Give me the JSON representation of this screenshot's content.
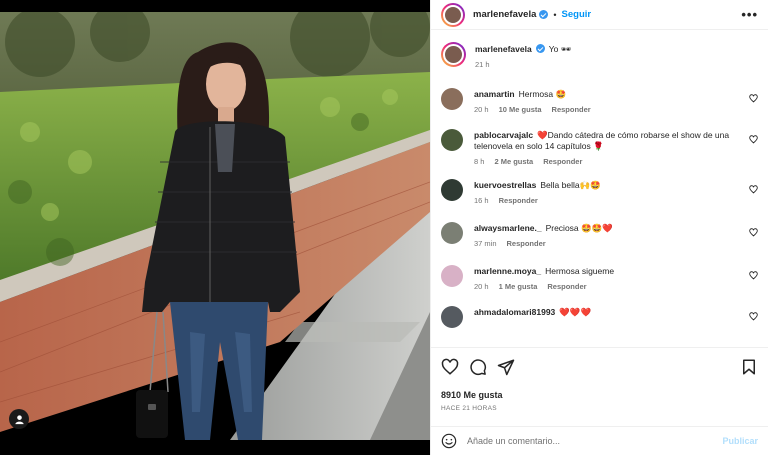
{
  "post": {
    "username": "marlenefavela",
    "follow_label": "Seguir",
    "more_label": "•••"
  },
  "caption": {
    "username": "marlenefavela",
    "text": "Yo 🕶",
    "time": "21 h"
  },
  "comments": [
    {
      "username": "anamartin",
      "text": "Hermosa 🤩",
      "time": "20 h",
      "likes": "10 Me gusta",
      "reply": "Responder",
      "avatar_color": "#8a6e5c"
    },
    {
      "username": "pablocarvajalc",
      "text": "❤️Dando cátedra de cómo robarse el show de una telenovela en solo 14 capítulos 🌹",
      "time": "8 h",
      "likes": "2 Me gusta",
      "reply": "Responder",
      "avatar_color": "#4a5a3a"
    },
    {
      "username": "kuervoestrellas",
      "text": "Bella bella🙌🤩",
      "time": "16 h",
      "likes": "",
      "reply": "Responder",
      "avatar_color": "#2f3a33"
    },
    {
      "username": "alwaysmarlene._",
      "text": "Preciosa 🤩🤩❤️",
      "time": "37 min",
      "likes": "",
      "reply": "Responder",
      "avatar_color": "#7b7f74"
    },
    {
      "username": "marlenne.moya_",
      "text": "Hermosa sigueme",
      "time": "20 h",
      "likes": "1 Me gusta",
      "reply": "Responder",
      "avatar_color": "#d8b1c6"
    },
    {
      "username": "ahmadalomari81993",
      "text": "❤️❤️❤️",
      "time": "",
      "likes": "",
      "reply": "",
      "avatar_color": "#555a60"
    }
  ],
  "likes_total": "8910 Me gusta",
  "posted_ago": "HACE 21 HORAS",
  "comment_input": {
    "placeholder": "Añade un comentario...",
    "publish_label": "Publicar"
  },
  "colors": {
    "accent": "#0095f6",
    "publish_disabled": "#b2dffc",
    "muted": "#737373",
    "heart": "#ed4956"
  }
}
